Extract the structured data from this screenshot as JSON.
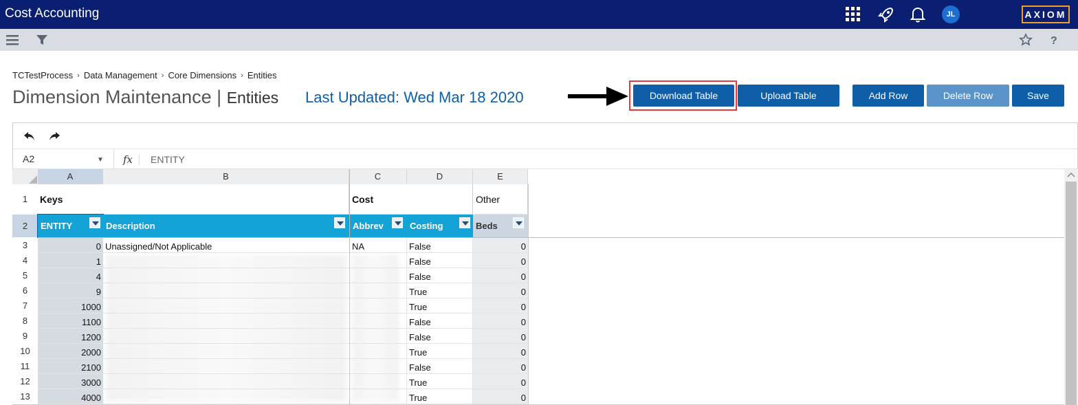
{
  "topbar": {
    "title": "Cost Accounting",
    "icons": [
      "apps-grid-icon",
      "rocket-icon",
      "bell-icon"
    ],
    "avatar_initials": "JL",
    "brand": "AXIOM"
  },
  "subbar": {
    "left_icons": [
      "hamburger-menu-icon",
      "filter-icon"
    ],
    "right_icons": [
      "star-icon",
      "help-icon"
    ]
  },
  "breadcrumb": [
    "TCTestProcess",
    "Data Management",
    "Core Dimensions",
    "Entities"
  ],
  "breadcrumb_sep": "›",
  "page": {
    "title": "Dimension Maintenance | ",
    "subtitle": "Entities",
    "last_updated": "Last Updated: Wed Mar 18 2020"
  },
  "buttons": {
    "download": "Download Table",
    "upload": "Upload Table",
    "add_row": "Add Row",
    "delete_row": "Delete Row",
    "save": "Save"
  },
  "toolbar_icons": [
    "undo-icon",
    "redo-icon"
  ],
  "formula": {
    "cell_ref": "A2",
    "fx": "fx",
    "value": "ENTITY"
  },
  "columns": [
    "A",
    "B",
    "C",
    "D",
    "E"
  ],
  "row1": {
    "keys": "Keys",
    "cost": "Cost",
    "other": "Other"
  },
  "headers": {
    "entity": "ENTITY",
    "description": "Description",
    "abbrev": "Abbrev",
    "costing": "Costing",
    "beds": "Beds"
  },
  "rows": [
    {
      "row": "3",
      "entity": "0",
      "description": "Unassigned/Not Applicable",
      "abbrev": "NA",
      "costing": "False",
      "beds": "0"
    },
    {
      "row": "4",
      "entity": "1",
      "description": "",
      "abbrev": "",
      "costing": "False",
      "beds": "0"
    },
    {
      "row": "5",
      "entity": "4",
      "description": "",
      "abbrev": "",
      "costing": "False",
      "beds": "0"
    },
    {
      "row": "6",
      "entity": "9",
      "description": "",
      "abbrev": "",
      "costing": "True",
      "beds": "0"
    },
    {
      "row": "7",
      "entity": "1000",
      "description": "",
      "abbrev": "",
      "costing": "True",
      "beds": "0"
    },
    {
      "row": "8",
      "entity": "1100",
      "description": "",
      "abbrev": "",
      "costing": "False",
      "beds": "0"
    },
    {
      "row": "9",
      "entity": "1200",
      "description": "",
      "abbrev": "",
      "costing": "False",
      "beds": "0"
    },
    {
      "row": "10",
      "entity": "2000",
      "description": "",
      "abbrev": "",
      "costing": "True",
      "beds": "0"
    },
    {
      "row": "11",
      "entity": "2100",
      "description": "",
      "abbrev": "",
      "costing": "False",
      "beds": "0"
    },
    {
      "row": "12",
      "entity": "3000",
      "description": "",
      "abbrev": "",
      "costing": "True",
      "beds": "0"
    },
    {
      "row": "13",
      "entity": "4000",
      "description": "",
      "abbrev": "",
      "costing": "True",
      "beds": "0"
    }
  ],
  "colors": {
    "topbar": "#0a1f72",
    "accent": "#0e5ea8",
    "header": "#14a3d6",
    "highlight": "#e23a3a",
    "brand_border": "#f0a030"
  }
}
